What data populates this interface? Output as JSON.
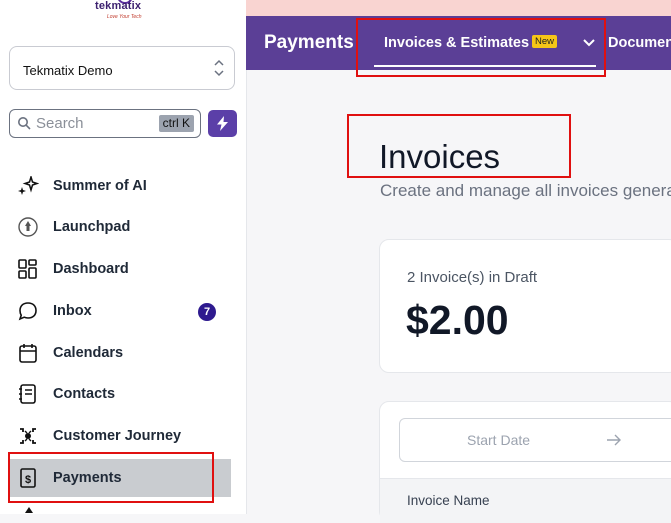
{
  "logo": {
    "name": "tekmatix",
    "tagline": "Love Your Tech"
  },
  "account": {
    "name": "Tekmatix Demo"
  },
  "search": {
    "placeholder": "Search",
    "shortcut": "ctrl K"
  },
  "sidebar": {
    "items": [
      {
        "label": "Summer of AI",
        "icon": "sparkle-icon"
      },
      {
        "label": "Launchpad",
        "icon": "rocket-icon"
      },
      {
        "label": "Dashboard",
        "icon": "grid-icon"
      },
      {
        "label": "Inbox",
        "icon": "chat-icon",
        "badge": "7"
      },
      {
        "label": "Calendars",
        "icon": "calendar-icon"
      },
      {
        "label": "Contacts",
        "icon": "contacts-icon"
      },
      {
        "label": "Customer Journey",
        "icon": "journey-icon"
      },
      {
        "label": "Payments",
        "icon": "receipt-icon",
        "active": true
      }
    ]
  },
  "topbar": {
    "title": "Payments",
    "tabs": [
      {
        "label": "Invoices & Estimates",
        "badge": "New",
        "active": true
      },
      {
        "label": "Documents"
      }
    ]
  },
  "main": {
    "title": "Invoices",
    "subtitle": "Create and manage all invoices generated"
  },
  "draft_card": {
    "label": "2 Invoice(s) in Draft",
    "amount": "$2.00"
  },
  "filters": {
    "start_date_placeholder": "Start Date"
  },
  "table": {
    "columns": [
      "Invoice Name"
    ]
  },
  "colors": {
    "brand_purple": "#5b3f96",
    "highlight_red": "#e01010",
    "badge_yellow": "#f5c518",
    "announce_pink": "#f9d4d1"
  }
}
